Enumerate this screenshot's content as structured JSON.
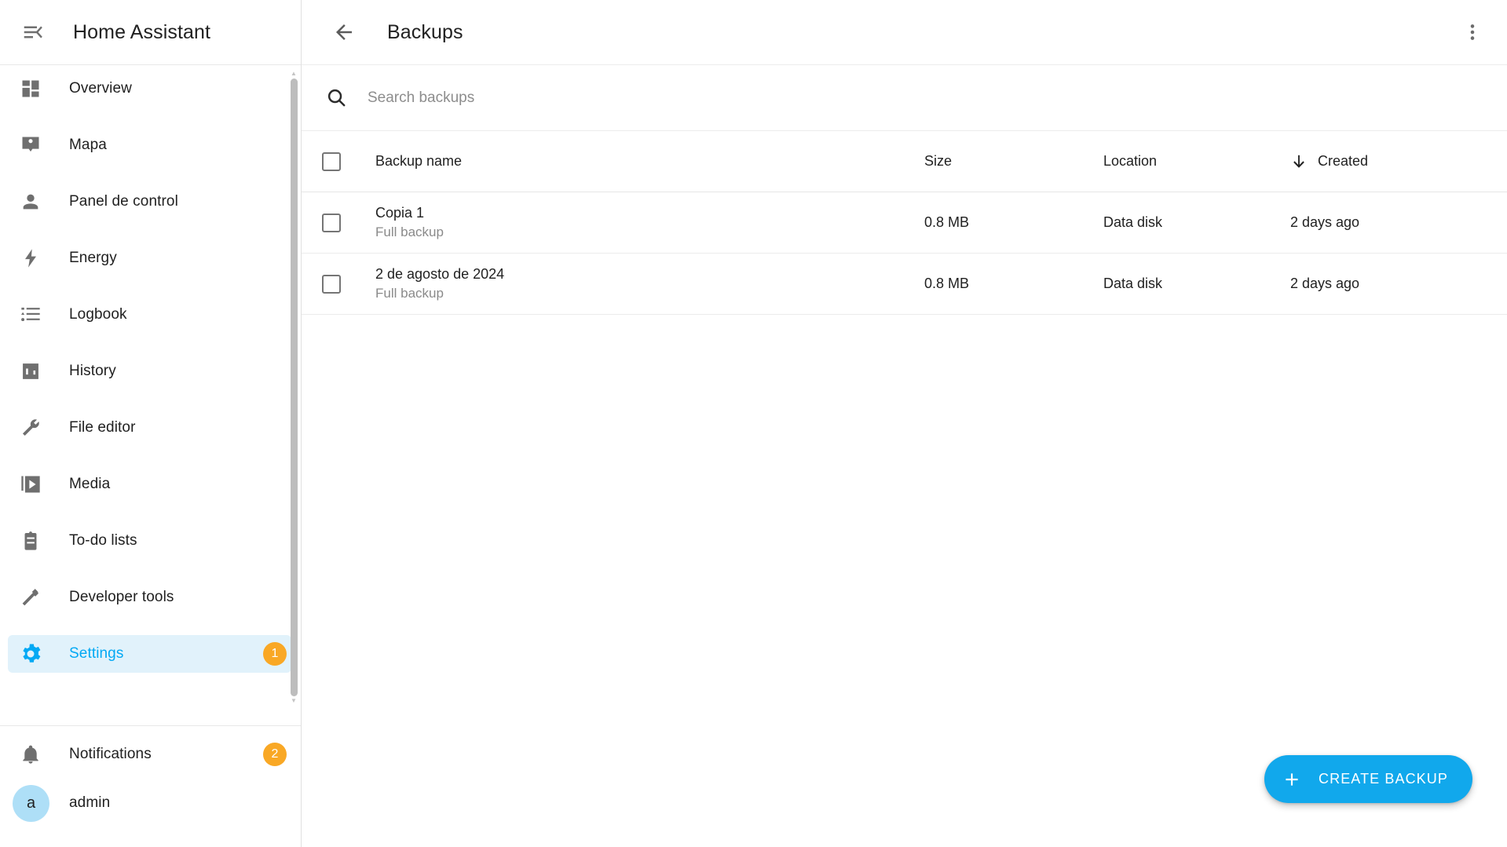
{
  "sidebar": {
    "menu_icon": "menu-open-icon",
    "title": "Home Assistant",
    "items": [
      {
        "label": "Overview",
        "icon": "view-dashboard-icon",
        "badge": null,
        "active": false
      },
      {
        "label": "Mapa",
        "icon": "map-marker-account-icon",
        "badge": null,
        "active": false
      },
      {
        "label": "Panel de control",
        "icon": "account-icon",
        "badge": null,
        "active": false
      },
      {
        "label": "Energy",
        "icon": "lightning-bolt-icon",
        "badge": null,
        "active": false
      },
      {
        "label": "Logbook",
        "icon": "format-list-bulleted-icon",
        "badge": null,
        "active": false
      },
      {
        "label": "History",
        "icon": "chart-box-icon",
        "badge": null,
        "active": false
      },
      {
        "label": "File editor",
        "icon": "wrench-icon",
        "badge": null,
        "active": false
      },
      {
        "label": "Media",
        "icon": "play-box-multiple-icon",
        "badge": null,
        "active": false
      },
      {
        "label": "To-do lists",
        "icon": "clipboard-list-icon",
        "badge": null,
        "active": false
      },
      {
        "label": "Developer tools",
        "icon": "hammer-icon",
        "badge": null,
        "active": false
      },
      {
        "label": "Settings",
        "icon": "cog-icon",
        "badge": "1",
        "active": true
      }
    ],
    "bottom": {
      "notifications": {
        "label": "Notifications",
        "icon": "bell-icon",
        "badge": "2"
      },
      "user": {
        "label": "admin",
        "avatar_initial": "a"
      }
    }
  },
  "toolbar": {
    "back_icon": "arrow-left-icon",
    "title": "Backups",
    "overflow_icon": "dots-vertical-icon"
  },
  "search": {
    "icon": "search-icon",
    "placeholder": "Search backups",
    "value": ""
  },
  "table": {
    "columns": {
      "name": "Backup name",
      "size": "Size",
      "location": "Location",
      "created": "Created"
    },
    "sort": {
      "column": "created",
      "direction": "descending",
      "icon": "arrow-down-icon"
    },
    "rows": [
      {
        "name": "Copia 1",
        "subtitle": "Full backup",
        "size": "0.8 MB",
        "location": "Data disk",
        "created": "2 days ago",
        "checked": false
      },
      {
        "name": "2 de agosto de 2024",
        "subtitle": "Full backup",
        "size": "0.8 MB",
        "location": "Data disk",
        "created": "2 days ago",
        "checked": false
      }
    ]
  },
  "fab": {
    "icon": "plus-icon",
    "label": "CREATE BACKUP"
  },
  "colors": {
    "accent": "#03a9f4",
    "fab": "#11a8ec",
    "badge": "#f9a825",
    "active_bg": "#e1f2fb",
    "avatar_bg": "#aedff7",
    "text": "#212121",
    "muted": "#8a8a8a"
  }
}
